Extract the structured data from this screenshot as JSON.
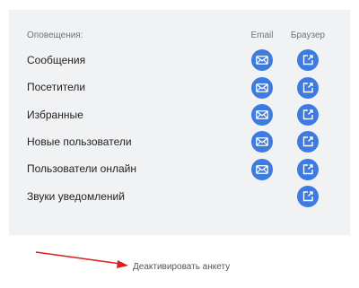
{
  "notifications": {
    "header": "Оповещения:",
    "columns": {
      "email": "Email",
      "browser": "Браузер"
    },
    "rows": [
      {
        "label": "Сообщения",
        "email": true,
        "browser": true
      },
      {
        "label": "Посетители",
        "email": true,
        "browser": true
      },
      {
        "label": "Избранные",
        "email": true,
        "browser": true
      },
      {
        "label": "Новые пользователи",
        "email": true,
        "browser": true
      },
      {
        "label": "Пользователи онлайн",
        "email": true,
        "browser": true
      },
      {
        "label": "Звуки уведомлений",
        "email": false,
        "browser": true
      }
    ]
  },
  "deactivate_link": "Деактивировать анкету",
  "icons": {
    "email": "envelope-icon",
    "browser": "browser-push-icon"
  },
  "colors": {
    "panel_bg": "#f1f2f4",
    "button": "#3d7be0",
    "arrow": "#e01b1b"
  }
}
